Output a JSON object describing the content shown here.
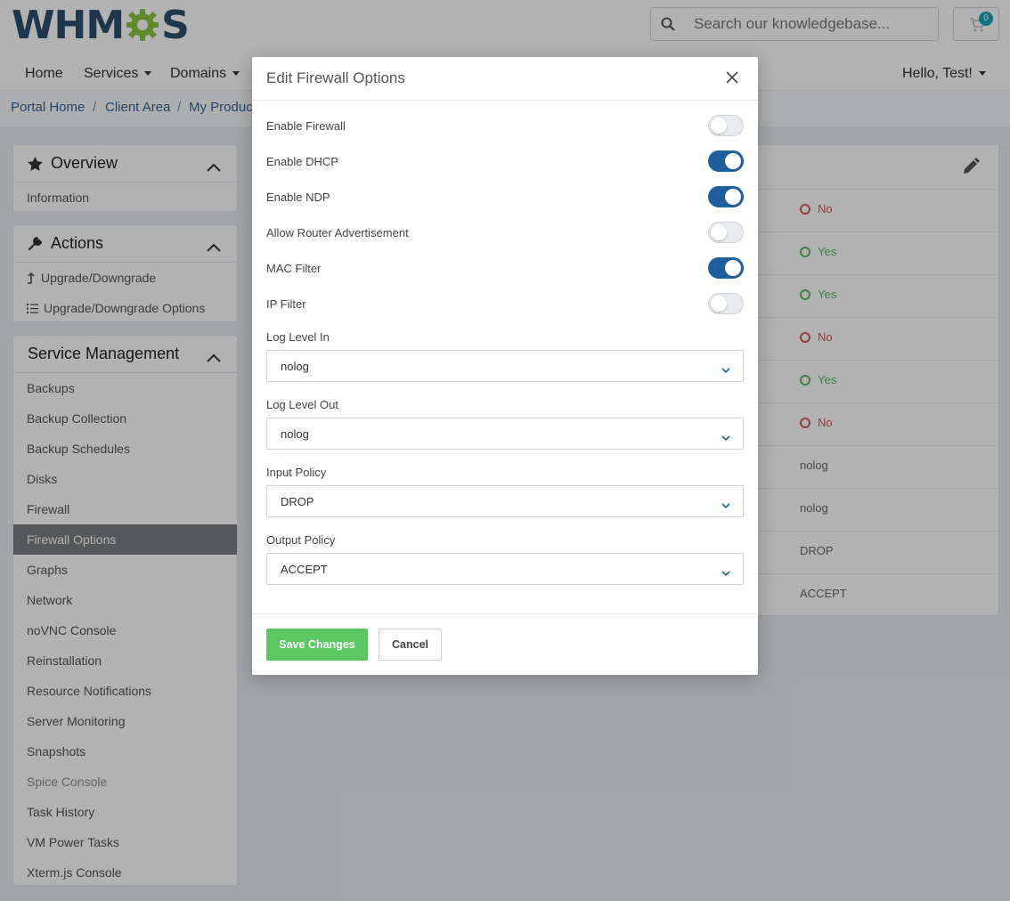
{
  "header": {
    "logo_text_left": "WHM",
    "logo_text_right": "S",
    "search_placeholder": "Search our knowledgebase...",
    "cart_count": "0"
  },
  "nav": {
    "home": "Home",
    "services": "Services",
    "domains": "Domains",
    "user": "Hello, Test!"
  },
  "breadcrumb": [
    "Portal Home",
    "Client Area",
    "My Produc"
  ],
  "sidebar": {
    "overview_title": "Overview",
    "overview_items": [
      "Information"
    ],
    "actions_title": "Actions",
    "actions_items": [
      "Upgrade/Downgrade",
      "Upgrade/Downgrade Options"
    ],
    "service_title": "Service Management",
    "service_items": [
      "Backups",
      "Backup Collection",
      "Backup Schedules",
      "Disks",
      "Firewall",
      "Firewall Options",
      "Graphs",
      "Network",
      "noVNC Console",
      "Reinstallation",
      "Resource Notifications",
      "Server Monitoring",
      "Snapshots",
      "Spice Console",
      "Task History",
      "VM Power Tasks",
      "Xterm.js Console"
    ],
    "active_item": "Firewall Options"
  },
  "content_values": [
    {
      "status": "no",
      "text": "No"
    },
    {
      "status": "yes",
      "text": "Yes"
    },
    {
      "status": "yes",
      "text": "Yes"
    },
    {
      "status": "no",
      "text": "No"
    },
    {
      "status": "yes",
      "text": "Yes"
    },
    {
      "status": "no",
      "text": "No"
    },
    {
      "status": "",
      "text": "nolog"
    },
    {
      "status": "",
      "text": "nolog"
    },
    {
      "status": "",
      "text": "DROP"
    },
    {
      "status": "",
      "text": "ACCEPT"
    }
  ],
  "modal": {
    "title": "Edit Firewall Options",
    "toggles": [
      {
        "label": "Enable Firewall",
        "on": false
      },
      {
        "label": "Enable DHCP",
        "on": true
      },
      {
        "label": "Enable NDP",
        "on": true
      },
      {
        "label": "Allow Router Advertisement",
        "on": false
      },
      {
        "label": "MAC Filter",
        "on": true
      },
      {
        "label": "IP Filter",
        "on": false
      }
    ],
    "selects": [
      {
        "label": "Log Level In",
        "value": "nolog"
      },
      {
        "label": "Log Level Out",
        "value": "nolog"
      },
      {
        "label": "Input Policy",
        "value": "DROP"
      },
      {
        "label": "Output Policy",
        "value": "ACCEPT"
      }
    ],
    "save_label": "Save Changes",
    "cancel_label": "Cancel"
  },
  "colors": {
    "brand": "#2b4f6f",
    "logo_gear": "#8cc63f",
    "toggle_on": "#1f5e9c",
    "save_button": "#5cc862",
    "status_no": "#d9534f",
    "status_yes": "#5cb85c"
  }
}
